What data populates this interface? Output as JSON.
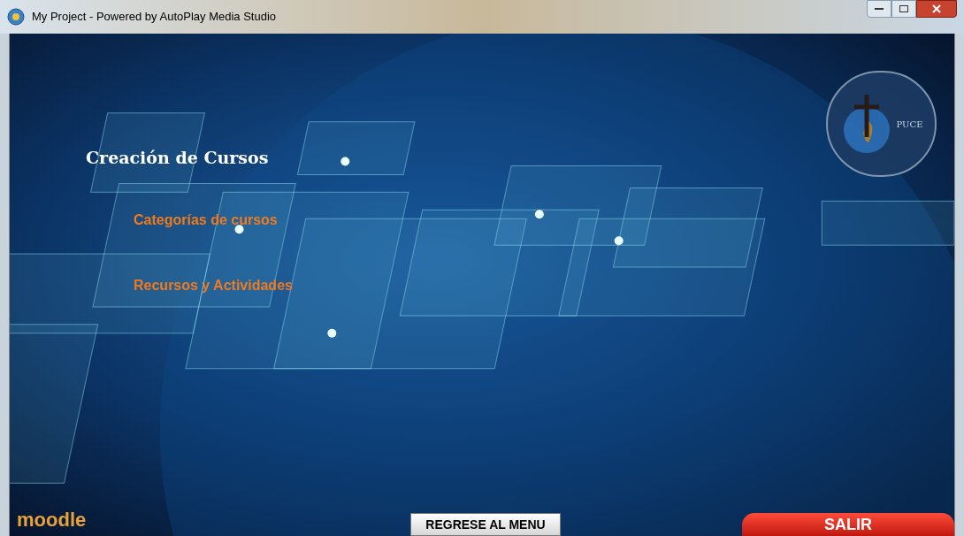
{
  "window": {
    "title": "My Project - Powered by AutoPlay Media Studio"
  },
  "heading": "Creación de Cursos",
  "menu": [
    {
      "label": "Categorías de cursos"
    },
    {
      "label": "Recursos y Actividades"
    }
  ],
  "seal": {
    "label": "PUCE"
  },
  "footer": {
    "logo": "moodle",
    "back_button": "REGRESE AL MENU",
    "exit_button": "SALIR"
  }
}
